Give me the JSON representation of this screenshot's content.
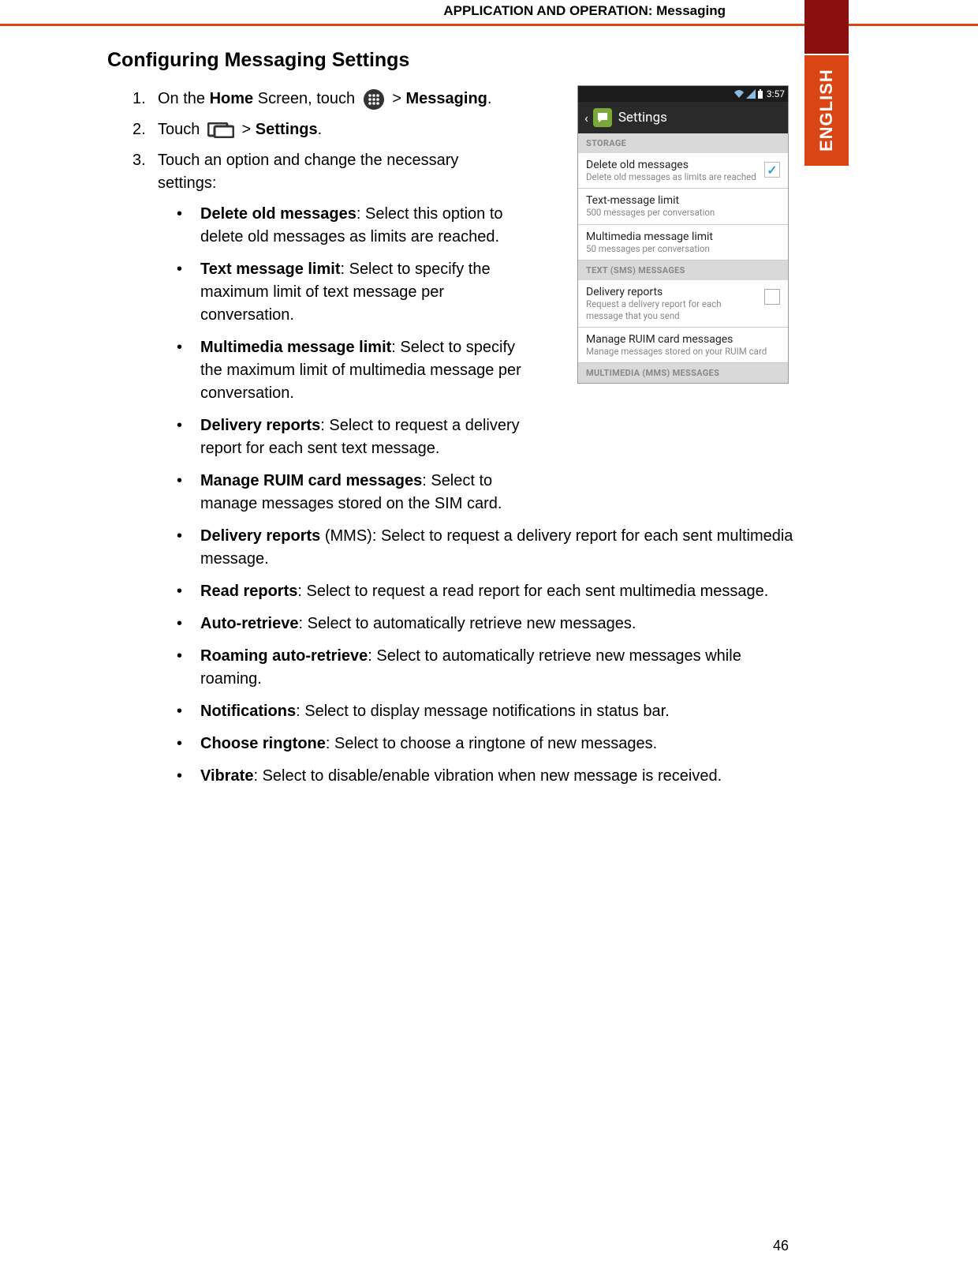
{
  "breadcrumb": "APPLICATION AND OPERATION: Messaging",
  "language_tab": "ENGLISH",
  "section_title": "Configuring Messaging Settings",
  "steps": {
    "s1": {
      "num": "1.",
      "pre": "On the ",
      "bold1": "Home",
      "mid": " Screen, touch ",
      "gt": " > ",
      "bold2": "Messaging",
      "post": "."
    },
    "s2": {
      "num": "2.",
      "pre": "Touch ",
      "gt": " > ",
      "bold": "Settings",
      "post": "."
    },
    "s3": {
      "num": "3.",
      "text": "Touch an option and change the necessary settings:"
    }
  },
  "bullets": [
    {
      "bold": "Delete old messages",
      "rest": ": Select this option to delete old messages as limits are reached."
    },
    {
      "bold": "Text message limit",
      "rest": ": Select to specify the maximum limit of text message per conversation."
    },
    {
      "bold": "Multimedia message limit",
      "rest": ": Select to specify the maximum limit of multimedia message per conversation."
    },
    {
      "bold": "Delivery reports",
      "rest": ": Select to request a delivery report for each sent text message."
    },
    {
      "bold": "Manage RUIM card messages",
      "rest": ": Select to manage messages stored on the SIM card."
    },
    {
      "bold": "Delivery reports",
      "rest": " (MMS): Select to request a delivery report for each sent multimedia message."
    },
    {
      "bold": "Read reports",
      "rest": ": Select to request a read report for each sent multimedia message."
    },
    {
      "bold": "Auto-retrieve",
      "rest": ": Select to automatically retrieve new messages."
    },
    {
      "bold": "Roaming auto-retrieve",
      "rest": ": Select to automatically retrieve new messages while roaming."
    },
    {
      "bold": "Notifications",
      "rest": ": Select to display message notifications in status bar."
    },
    {
      "bold": "Choose ringtone",
      "rest": ": Select to choose a ringtone of new messages."
    },
    {
      "bold": "Vibrate",
      "rest": ": Select to disable/enable vibration when new message is received."
    }
  ],
  "phone": {
    "time": "3:57",
    "title": "Settings",
    "section_storage": "STORAGE",
    "section_text": "TEXT (SMS) MESSAGES",
    "section_mms": "MULTIMEDIA (MMS) MESSAGES",
    "items": {
      "delete_old": {
        "title": "Delete old messages",
        "sub": "Delete old messages as limits are reached"
      },
      "text_limit": {
        "title": "Text-message limit",
        "sub": "500 messages per conversation"
      },
      "mms_limit": {
        "title": "Multimedia message limit",
        "sub": "50 messages per conversation"
      },
      "delivery": {
        "title": "Delivery reports",
        "sub": "Request a delivery report for each message that you send"
      },
      "ruim": {
        "title": "Manage RUIM card messages",
        "sub": "Manage messages stored on your RUIM card"
      }
    }
  },
  "page_number": "46"
}
